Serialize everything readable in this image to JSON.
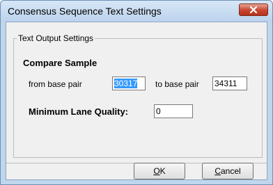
{
  "window": {
    "title": "Consensus Sequence Text Settings"
  },
  "group": {
    "label": "Text Output Settings"
  },
  "compare": {
    "heading": "Compare Sample",
    "from_label": "from base pair",
    "from_value": "30317",
    "to_label": "to base pair",
    "to_value": "34311"
  },
  "quality": {
    "label": "Minimum Lane Quality:",
    "value": "0"
  },
  "buttons": {
    "ok_mnemonic": "O",
    "ok_rest": "K",
    "cancel_mnemonic": "C",
    "cancel_rest": "ancel"
  },
  "icons": {
    "close": "close-x-icon"
  },
  "colors": {
    "close_button": "#c7452d",
    "selection": "#3399ff"
  }
}
